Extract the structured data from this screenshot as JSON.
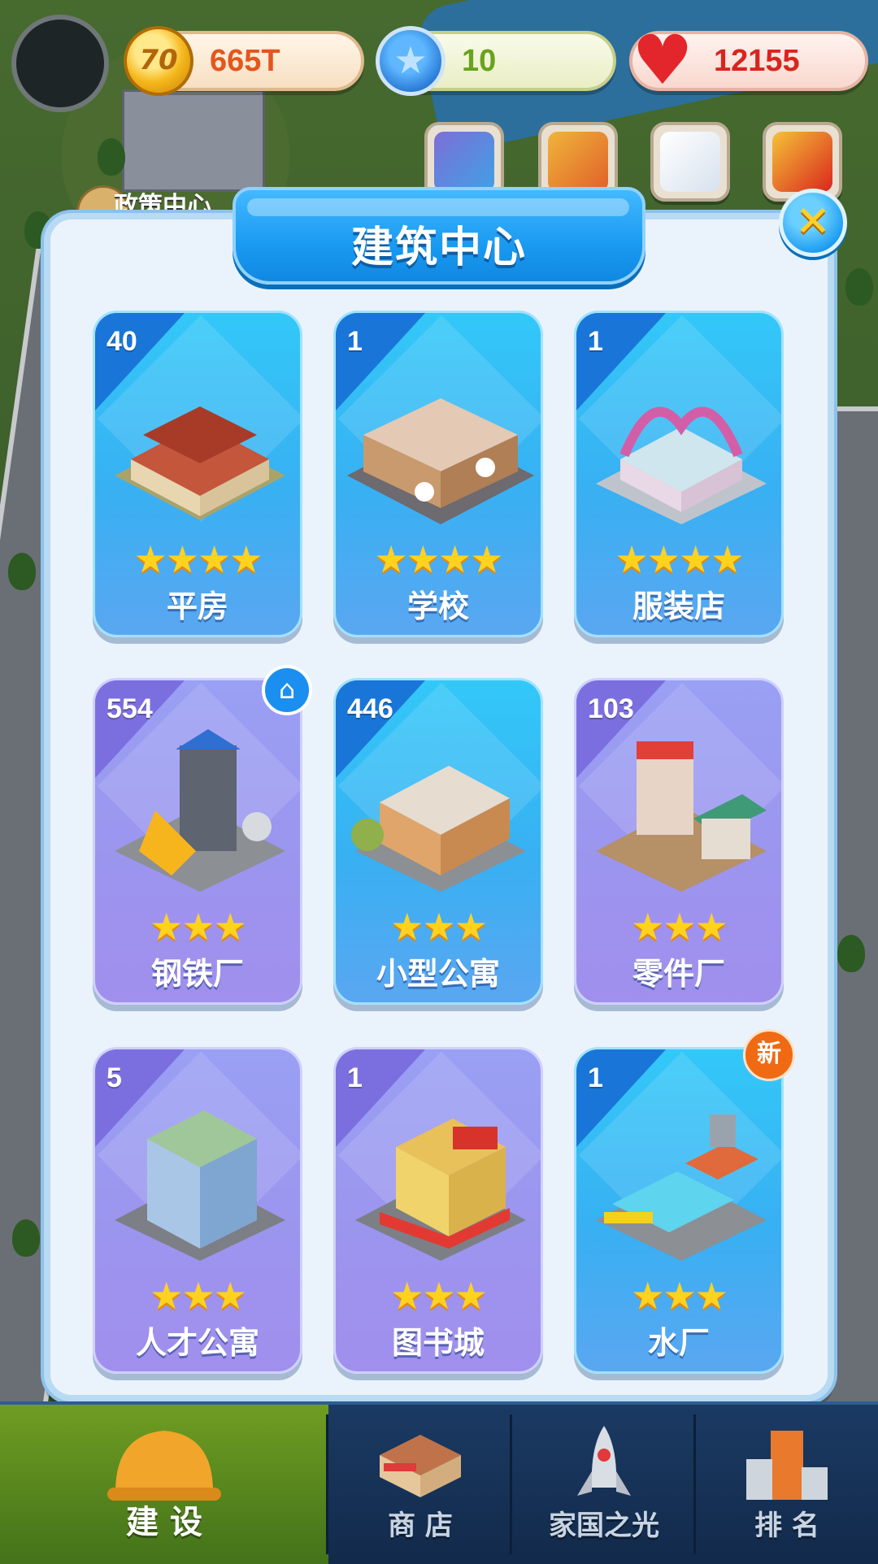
{
  "resources": {
    "gold": "665T",
    "gold_icon_text": "70",
    "stars": "10",
    "hearts": "12155"
  },
  "policy_label": "政策中心",
  "panel": {
    "title": "建筑中心"
  },
  "buildings": [
    {
      "count": "40",
      "name": "平房",
      "stars": "★★★★"
    },
    {
      "count": "1",
      "name": "学校",
      "stars": "★★★★"
    },
    {
      "count": "1",
      "name": "服装店",
      "stars": "★★★★"
    },
    {
      "count": "554",
      "name": "钢铁厂",
      "stars": "★★★"
    },
    {
      "count": "446",
      "name": "小型公寓",
      "stars": "★★★"
    },
    {
      "count": "103",
      "name": "零件厂",
      "stars": "★★★"
    },
    {
      "count": "5",
      "name": "人才公寓",
      "stars": "★★★"
    },
    {
      "count": "1",
      "name": "图书城",
      "stars": "★★★"
    },
    {
      "count": "1",
      "name": "水厂",
      "stars": "★★★"
    }
  ],
  "badges": {
    "new": "新"
  },
  "nav": [
    {
      "label": "建 设"
    },
    {
      "label": "商 店"
    },
    {
      "label": "家国之光"
    },
    {
      "label": "排 名"
    }
  ],
  "colors": {
    "card_blue": "#38b0f2",
    "card_purple": "#9b95ee",
    "title_blue": "#1a9af1",
    "star_gold": "#ffd21f",
    "nav_active": "#5a8a1e"
  }
}
